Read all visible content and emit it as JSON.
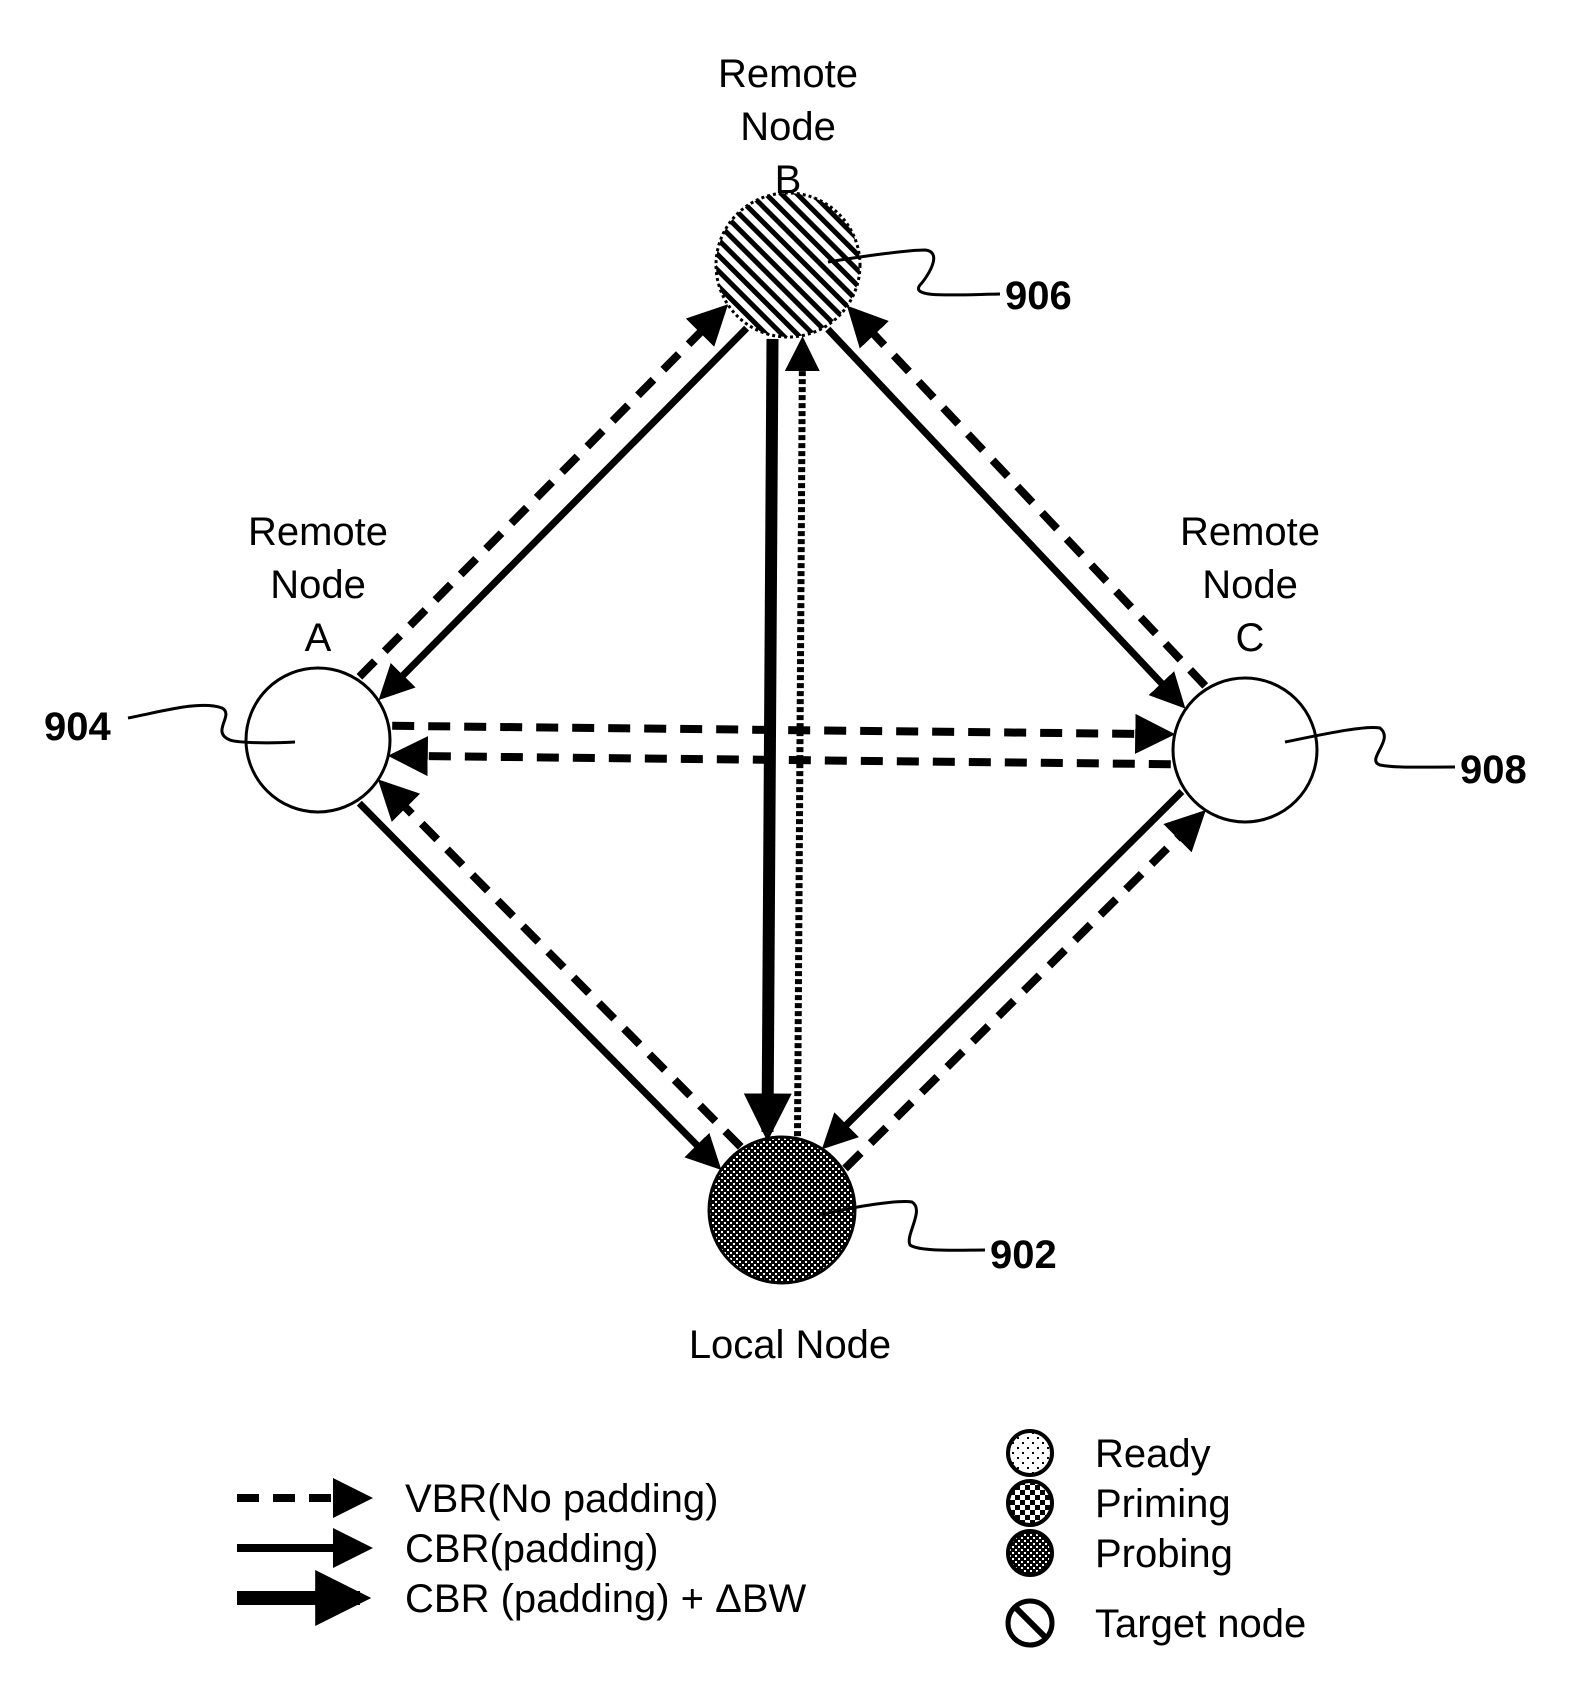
{
  "diagram": {
    "nodes": {
      "local": {
        "label_lines": [
          "Local Node"
        ],
        "ref": "902",
        "state": "Probing"
      },
      "a": {
        "label_lines": [
          "Remote",
          "Node",
          "A"
        ],
        "ref": "904",
        "state": "Ready"
      },
      "b": {
        "label_lines": [
          "Remote",
          "Node",
          "B"
        ],
        "ref": "906",
        "state": "Target node"
      },
      "c": {
        "label_lines": [
          "Remote",
          "Node",
          "C"
        ],
        "ref": "908",
        "state": "Ready"
      }
    },
    "links": [
      {
        "from": "a",
        "to": "b",
        "type": "VBR"
      },
      {
        "from": "b",
        "to": "a",
        "type": "CBR"
      },
      {
        "from": "c",
        "to": "b",
        "type": "VBR"
      },
      {
        "from": "b",
        "to": "c",
        "type": "CBR"
      },
      {
        "from": "a",
        "to": "c",
        "type": "VBR"
      },
      {
        "from": "c",
        "to": "a",
        "type": "VBR"
      },
      {
        "from": "local",
        "to": "a",
        "type": "VBR"
      },
      {
        "from": "a",
        "to": "local",
        "type": "CBR"
      },
      {
        "from": "local",
        "to": "c",
        "type": "VBR"
      },
      {
        "from": "c",
        "to": "local",
        "type": "CBR"
      },
      {
        "from": "local",
        "to": "b",
        "type": "CBR_DOTTED"
      },
      {
        "from": "b",
        "to": "local",
        "type": "CBR_BW"
      }
    ]
  },
  "legend": {
    "arrows": [
      {
        "type": "VBR",
        "label": "VBR(No padding)"
      },
      {
        "type": "CBR",
        "label": "CBR(padding)"
      },
      {
        "type": "CBR_BW",
        "label": "CBR (padding) + ΔBW"
      }
    ],
    "states": [
      {
        "pattern": "ready",
        "label": "Ready"
      },
      {
        "pattern": "priming",
        "label": "Priming"
      },
      {
        "pattern": "probing",
        "label": "Probing"
      },
      {
        "pattern": "target",
        "label": "Target node"
      }
    ]
  }
}
